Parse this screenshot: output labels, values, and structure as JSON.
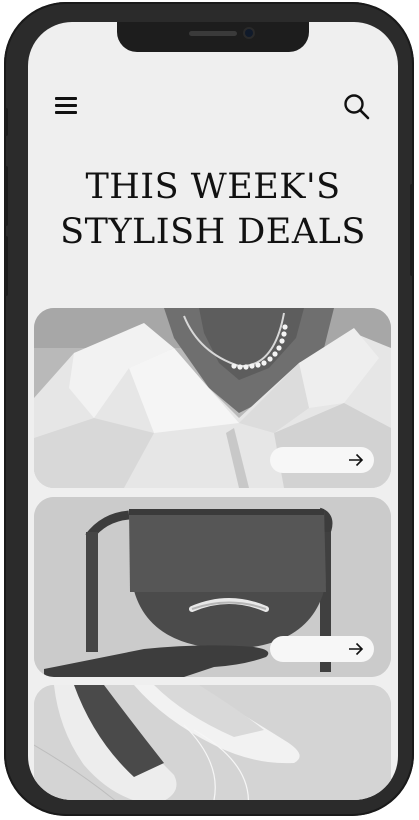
{
  "header": {
    "menu_icon": "hamburger-menu-icon",
    "search_icon": "search-icon"
  },
  "hero": {
    "title_line1": "THIS WEEK'S",
    "title_line2": "STYLISH DEALS"
  },
  "deals": [
    {
      "image": "necklace-model-photo",
      "action_icon": "arrow-right-icon"
    },
    {
      "image": "handbag-photo",
      "action_icon": "arrow-right-icon"
    },
    {
      "image": "shoes-photo"
    }
  ],
  "colors": {
    "screen_background": "#efefef",
    "text": "#111111",
    "phone_frame": "#2b2b2b",
    "pill_button": "#f7f7f7"
  }
}
